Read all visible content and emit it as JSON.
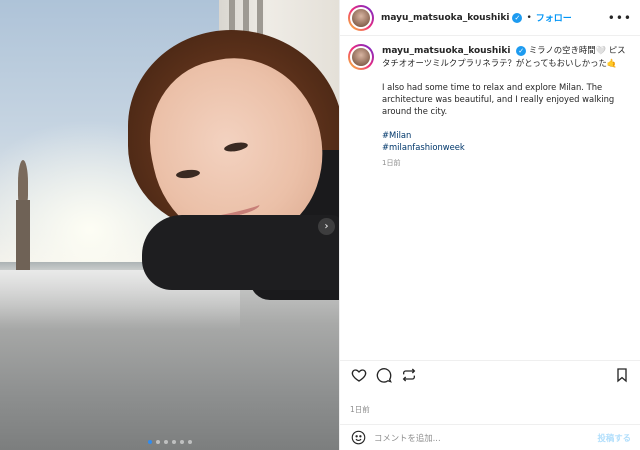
{
  "post": {
    "username": "mayu_matsuoka_koushiki",
    "follow_label": "フォロー",
    "separator": "•",
    "more_label": "•••"
  },
  "caption": {
    "username": "mayu_matsuoka_koushiki",
    "jp_text": "ミラノの空き時間🤍 ピスタチオオーツミルクプラリネラテ？がとってもおいしかった🤙",
    "en_text": "I also had some time to relax and explore Milan. The architecture was beautiful, and I really enjoyed walking around the city.",
    "tags": [
      "#Milan",
      "#milanfashionweek"
    ],
    "time": "1日前"
  },
  "actions": {
    "like_icon": "heart-icon",
    "comment_icon": "comment-icon",
    "share_icon": "repost-icon",
    "save_icon": "bookmark-icon"
  },
  "date_label": "1日前",
  "comment_box": {
    "placeholder": "コメントを追加...",
    "post_label": "投稿する"
  },
  "carousel": {
    "slide_count": 6,
    "active_index": 0,
    "next_icon": "chevron-right-icon"
  },
  "colors": {
    "accent": "#0095f6",
    "link": "#00376b",
    "muted": "#8e8e8e"
  }
}
